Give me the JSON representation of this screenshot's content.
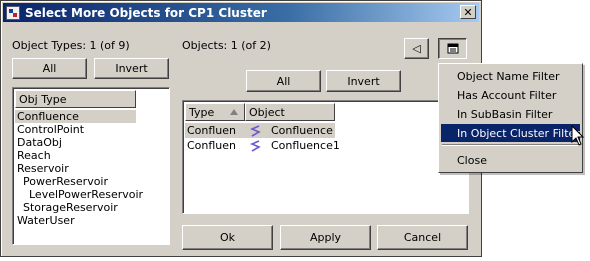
{
  "window": {
    "title": "Select More Objects for CP1 Cluster",
    "close_glyph": "✕"
  },
  "left_panel": {
    "count_label": "Object Types: 1 (of 9)",
    "all_button": "All",
    "invert_button": "Invert",
    "list_header": "Obj Type",
    "items": [
      {
        "label": "Confluence",
        "indent": 0,
        "selected": true
      },
      {
        "label": "ControlPoint",
        "indent": 0
      },
      {
        "label": "DataObj",
        "indent": 0
      },
      {
        "label": "Reach",
        "indent": 0
      },
      {
        "label": "Reservoir",
        "indent": 0
      },
      {
        "label": "PowerReservoir",
        "indent": 1
      },
      {
        "label": "LevelPowerReservoir",
        "indent": 2
      },
      {
        "label": "StorageReservoir",
        "indent": 1
      },
      {
        "label": "WaterUser",
        "indent": 0
      }
    ]
  },
  "right_panel": {
    "count_label": "Objects: 1 (of 2)",
    "all_button": "All",
    "invert_button": "Invert",
    "columns": {
      "type": "Type",
      "object": "Object"
    },
    "rows": [
      {
        "type": "Confluen",
        "object": "Confluence",
        "selected": true
      },
      {
        "type": "Confluen",
        "object": "Confluence1",
        "selected": false
      }
    ],
    "icon_color": "#6a5acd"
  },
  "toolbar": {
    "left_arrow_icon": "◁",
    "filter_icon": "filter-menu-icon"
  },
  "bottom_buttons": {
    "ok": "Ok",
    "apply": "Apply",
    "cancel": "Cancel"
  },
  "filter_menu": {
    "items": [
      {
        "label": "Object Name Filter"
      },
      {
        "label": "Has Account Filter"
      },
      {
        "label": "In SubBasin Filter"
      },
      {
        "label": "In Object Cluster Filter",
        "active": true
      }
    ],
    "close_label": "Close",
    "highlight_color": "#0a246a"
  }
}
